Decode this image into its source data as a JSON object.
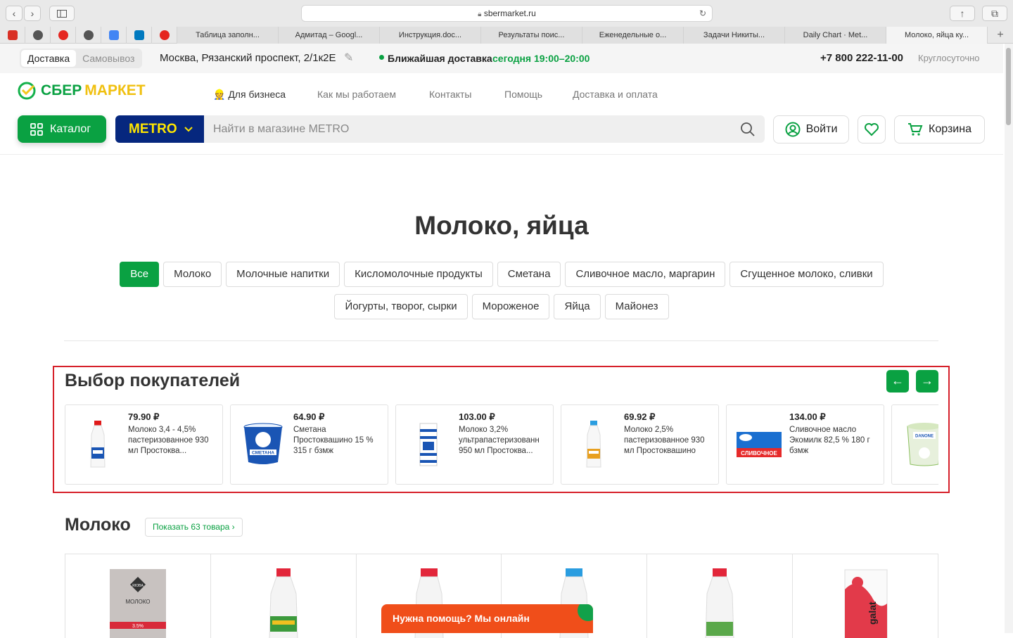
{
  "browser": {
    "url": "sbermarket.ru",
    "back": "‹",
    "forward": "›",
    "pinned_tabs": [
      {
        "icon": "gmail-icon",
        "color": "#d93025"
      },
      {
        "icon": "avatar-icon",
        "color": "#555555"
      },
      {
        "icon": "yandex-icon",
        "color": "#e52620"
      },
      {
        "icon": "avatar-icon",
        "color": "#555555"
      },
      {
        "icon": "docs-icon",
        "color": "#4285f4"
      },
      {
        "icon": "trello-icon",
        "color": "#0079bf"
      },
      {
        "icon": "yandex-icon",
        "color": "#e52620"
      }
    ],
    "tabs": [
      "Таблица заполн...",
      "Адмитад – Googl...",
      "Инструкция.doc...",
      "Результаты поис...",
      "Еженедельные о...",
      "Задачи Никиты...",
      "Daily Chart · Met...",
      "Молоко, яйца ку..."
    ],
    "new_tab": "+"
  },
  "infobar": {
    "delivery": "Доставка",
    "pickup": "Самовывоз",
    "address": "Москва, Рязанский проспект, 2/1к2Е",
    "nearest_label": "Ближайшая доставка",
    "nearest_time": "сегодня 19:00–20:00",
    "phone": "+7 800 222-11-00",
    "hours": "Круглосуточно"
  },
  "header": {
    "logo_part1": "СБЕР",
    "logo_part2": "МАРКЕТ",
    "nav": [
      "Для бизнеса",
      "Как мы работаем",
      "Контакты",
      "Помощь",
      "Доставка и оплата"
    ],
    "catalog": "Каталог",
    "store": "METRO",
    "search_placeholder": "Найти в магазине METRO",
    "login": "Войти",
    "cart": "Корзина"
  },
  "page": {
    "title": "Молоко, яйца",
    "chips_row1": [
      "Все",
      "Молоко",
      "Молочные напитки",
      "Кисломолочные продукты",
      "Сметана",
      "Сливочное масло, маргарин",
      "Сгущенное молоко, сливки"
    ],
    "chips_row2": [
      "Йогурты, творог, сырки",
      "Мороженое",
      "Яйца",
      "Майонез"
    ]
  },
  "picks": {
    "title": "Выбор покупателей",
    "items": [
      {
        "price": "79.90 ₽",
        "name": "Молоко 3,4 - 4,5% пастеризованное 930 мл Простоква..."
      },
      {
        "price": "64.90 ₽",
        "name": "Сметана Простоквашино 15 % 315 г бзмж"
      },
      {
        "price": "103.00 ₽",
        "name": "Молоко 3,2% ультрапастеризованн 950 мл Простоква..."
      },
      {
        "price": "69.92 ₽",
        "name": "Молоко 2,5% пастеризованное 930 мл Простоквашино"
      },
      {
        "price": "134.00 ₽",
        "name": "Сливочное масло Экомилк 82,5 % 180 г бзмж"
      },
      {
        "price": "",
        "name": ""
      }
    ],
    "product_labels": {
      "sour_cream": "СМЕТАНА",
      "butter": "СЛИВОЧНОЕ",
      "danone": "DANONE"
    }
  },
  "milk_section": {
    "title": "Молоко",
    "show_all": "Показать 63 товара ›",
    "riola_brand": "RIOBA",
    "riola_name": "МОЛОКО",
    "riola_fat": "3.5%",
    "galat_brand": "galat"
  },
  "help": {
    "text": "Нужна помощь? Мы онлайн"
  },
  "colors": {
    "accent": "#0aa142",
    "metro": "#06277e",
    "metro_text": "#ffe600",
    "highlight": "#d6202a",
    "help_bg": "#f04e1a"
  }
}
